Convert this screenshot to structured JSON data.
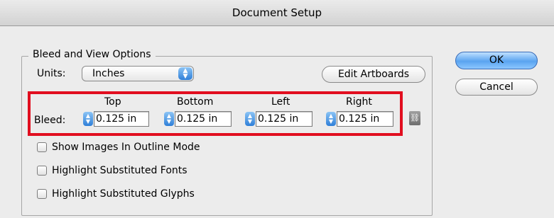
{
  "window": {
    "title": "Document Setup"
  },
  "group": {
    "legend": "Bleed and View Options"
  },
  "units": {
    "label": "Units:",
    "value": "Inches"
  },
  "buttons": {
    "edit_artboards": "Edit Artboards",
    "ok": "OK",
    "cancel": "Cancel"
  },
  "bleed": {
    "label": "Bleed:",
    "headers": [
      "Top",
      "Bottom",
      "Left",
      "Right"
    ],
    "values": [
      "0.125 in",
      "0.125 in",
      "0.125 in",
      "0.125 in"
    ],
    "link_icon": "chain-link-icon"
  },
  "options": [
    {
      "label": "Show Images In Outline Mode",
      "checked": false
    },
    {
      "label": "Highlight Substituted Fonts",
      "checked": false
    },
    {
      "label": "Highlight Substituted Glyphs",
      "checked": false
    }
  ],
  "colors": {
    "highlight": "#e10e1f",
    "accent": "#2f7fd8"
  }
}
